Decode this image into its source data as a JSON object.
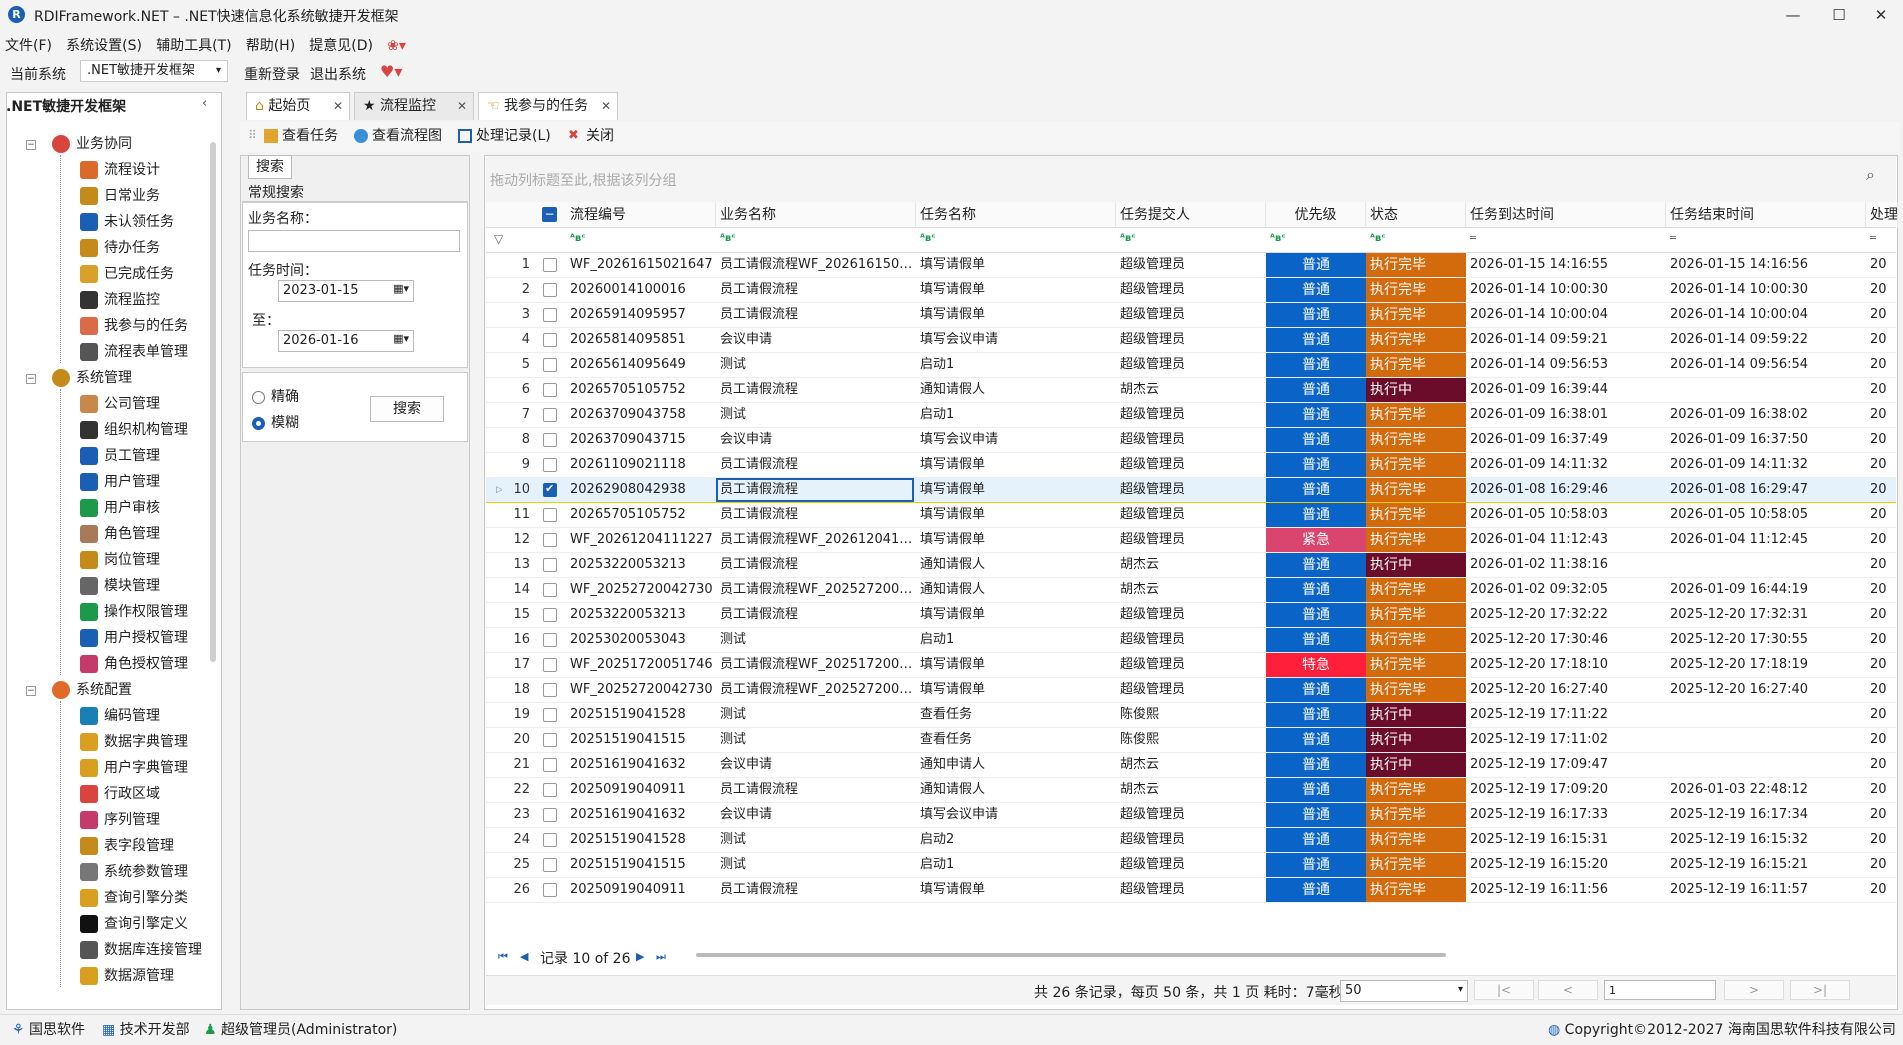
{
  "window": {
    "title": "RDIFramework.NET – .NET快速信息化系统敏捷开发框架",
    "logo": "R",
    "min": "—",
    "max": "☐",
    "close": "✕"
  },
  "menu": [
    "文件(F)",
    "系统设置(S)",
    "辅助工具(T)",
    "帮助(H)",
    "提意见(D)"
  ],
  "sysbar": {
    "label": "当前系统",
    "selected": ".NET敏捷开发框架",
    "relogin": "重新登录",
    "exit": "退出系统"
  },
  "left_panel": {
    "header": ".NET敏捷开发框架",
    "groups": [
      {
        "label": "业务协同",
        "items": [
          "流程设计",
          "日常业务",
          "未认领任务",
          "待办任务",
          "已完成任务",
          "流程监控",
          "我参与的任务",
          "流程表单管理"
        ]
      },
      {
        "label": "系统管理",
        "items": [
          "公司管理",
          "组织机构管理",
          "员工管理",
          "用户管理",
          "用户审核",
          "角色管理",
          "岗位管理",
          "模块管理",
          "操作权限管理",
          "用户授权管理",
          "角色授权管理"
        ]
      },
      {
        "label": "系统配置",
        "items": [
          "编码管理",
          "数据字典管理",
          "用户字典管理",
          "行政区域",
          "序列管理",
          "表字段管理",
          "系统参数管理",
          "查询引擎分类",
          "查询引擎定义",
          "数据库连接管理",
          "数据源管理"
        ]
      }
    ]
  },
  "tabs": [
    "起始页",
    "流程监控",
    "我参与的任务"
  ],
  "toolbar": [
    "查看任务",
    "查看流程图",
    "处理记录(L)",
    "关闭"
  ],
  "search": {
    "tab": "搜索",
    "section": "常规搜索",
    "biz_label": "业务名称：",
    "biz_value": "",
    "time_label": "任务时间：",
    "from": "2023-01-15",
    "to_label": "至：",
    "to": "2026-01-16",
    "exact": "精确",
    "fuzzy": "模糊",
    "button": "搜索"
  },
  "grid": {
    "group_hint": "拖动列标题至此,根据该列分组",
    "columns": [
      "流程编号",
      "业务名称",
      "任务名称",
      "任务提交人",
      "优先级",
      "状态",
      "任务到达时间",
      "任务结束时间",
      "处理"
    ],
    "rows": [
      {
        "n": "1",
        "id": "WF_20261615021647",
        "biz": "员工请假流程WF_202616150…",
        "task": "填写请假单",
        "user": "超级管理员",
        "pri": "普通",
        "st": "执行完毕",
        "arr": "2026-01-15 14:16:55",
        "end": "2026-01-15 14:16:56"
      },
      {
        "n": "2",
        "id": "20260014100016",
        "biz": "员工请假流程",
        "task": "填写请假单",
        "user": "超级管理员",
        "pri": "普通",
        "st": "执行完毕",
        "arr": "2026-01-14 10:00:30",
        "end": "2026-01-14 10:00:30"
      },
      {
        "n": "3",
        "id": "20265914095957",
        "biz": "员工请假流程",
        "task": "填写请假单",
        "user": "超级管理员",
        "pri": "普通",
        "st": "执行完毕",
        "arr": "2026-01-14 10:00:04",
        "end": "2026-01-14 10:00:04"
      },
      {
        "n": "4",
        "id": "20265814095851",
        "biz": "会议申请",
        "task": "填写会议申请",
        "user": "超级管理员",
        "pri": "普通",
        "st": "执行完毕",
        "arr": "2026-01-14 09:59:21",
        "end": "2026-01-14 09:59:22"
      },
      {
        "n": "5",
        "id": "20265614095649",
        "biz": "测试",
        "task": "启动1",
        "user": "超级管理员",
        "pri": "普通",
        "st": "执行完毕",
        "arr": "2026-01-14 09:56:53",
        "end": "2026-01-14 09:56:54"
      },
      {
        "n": "6",
        "id": "20265705105752",
        "biz": "员工请假流程",
        "task": "通知请假人",
        "user": "胡杰云",
        "pri": "普通",
        "st": "执行中",
        "arr": "2026-01-09 16:39:44",
        "end": ""
      },
      {
        "n": "7",
        "id": "20263709043758",
        "biz": "测试",
        "task": "启动1",
        "user": "超级管理员",
        "pri": "普通",
        "st": "执行完毕",
        "arr": "2026-01-09 16:38:01",
        "end": "2026-01-09 16:38:02"
      },
      {
        "n": "8",
        "id": "20263709043715",
        "biz": "会议申请",
        "task": "填写会议申请",
        "user": "超级管理员",
        "pri": "普通",
        "st": "执行完毕",
        "arr": "2026-01-09 16:37:49",
        "end": "2026-01-09 16:37:50"
      },
      {
        "n": "9",
        "id": "20261109021118",
        "biz": "员工请假流程",
        "task": "填写请假单",
        "user": "超级管理员",
        "pri": "普通",
        "st": "执行完毕",
        "arr": "2026-01-09 14:11:32",
        "end": "2026-01-09 14:11:32"
      },
      {
        "n": "10",
        "id": "20262908042938",
        "biz": "员工请假流程",
        "task": "填写请假单",
        "user": "超级管理员",
        "pri": "普通",
        "st": "执行完毕",
        "arr": "2026-01-08 16:29:46",
        "end": "2026-01-08 16:29:47"
      },
      {
        "n": "11",
        "id": "20265705105752",
        "biz": "员工请假流程",
        "task": "填写请假单",
        "user": "超级管理员",
        "pri": "普通",
        "st": "执行完毕",
        "arr": "2026-01-05 10:58:03",
        "end": "2026-01-05 10:58:05"
      },
      {
        "n": "12",
        "id": "WF_20261204111227",
        "biz": "员工请假流程WF_202612041…",
        "task": "填写请假单",
        "user": "超级管理员",
        "pri": "紧急",
        "st": "执行完毕",
        "arr": "2026-01-04 11:12:43",
        "end": "2026-01-04 11:12:45"
      },
      {
        "n": "13",
        "id": "20253220053213",
        "biz": "员工请假流程",
        "task": "通知请假人",
        "user": "胡杰云",
        "pri": "普通",
        "st": "执行中",
        "arr": "2026-01-02 11:38:16",
        "end": ""
      },
      {
        "n": "14",
        "id": "WF_20252720042730",
        "biz": "员工请假流程WF_202527200…",
        "task": "通知请假人",
        "user": "胡杰云",
        "pri": "普通",
        "st": "执行完毕",
        "arr": "2026-01-02 09:32:05",
        "end": "2026-01-09 16:44:19"
      },
      {
        "n": "15",
        "id": "20253220053213",
        "biz": "员工请假流程",
        "task": "填写请假单",
        "user": "超级管理员",
        "pri": "普通",
        "st": "执行完毕",
        "arr": "2025-12-20 17:32:22",
        "end": "2025-12-20 17:32:31"
      },
      {
        "n": "16",
        "id": "20253020053043",
        "biz": "测试",
        "task": "启动1",
        "user": "超级管理员",
        "pri": "普通",
        "st": "执行完毕",
        "arr": "2025-12-20 17:30:46",
        "end": "2025-12-20 17:30:55"
      },
      {
        "n": "17",
        "id": "WF_20251720051746",
        "biz": "员工请假流程WF_202517200…",
        "task": "填写请假单",
        "user": "超级管理员",
        "pri": "特急",
        "st": "执行完毕",
        "arr": "2025-12-20 17:18:10",
        "end": "2025-12-20 17:18:19"
      },
      {
        "n": "18",
        "id": "WF_20252720042730",
        "biz": "员工请假流程WF_202527200…",
        "task": "填写请假单",
        "user": "超级管理员",
        "pri": "普通",
        "st": "执行完毕",
        "arr": "2025-12-20 16:27:40",
        "end": "2025-12-20 16:27:40"
      },
      {
        "n": "19",
        "id": "20251519041528",
        "biz": "测试",
        "task": "查看任务",
        "user": "陈俊熙",
        "pri": "普通",
        "st": "执行中",
        "arr": "2025-12-19 17:11:22",
        "end": ""
      },
      {
        "n": "20",
        "id": "20251519041515",
        "biz": "测试",
        "task": "查看任务",
        "user": "陈俊熙",
        "pri": "普通",
        "st": "执行中",
        "arr": "2025-12-19 17:11:02",
        "end": ""
      },
      {
        "n": "21",
        "id": "20251619041632",
        "biz": "会议申请",
        "task": "通知申请人",
        "user": "胡杰云",
        "pri": "普通",
        "st": "执行中",
        "arr": "2025-12-19 17:09:47",
        "end": ""
      },
      {
        "n": "22",
        "id": "20250919040911",
        "biz": "员工请假流程",
        "task": "通知请假人",
        "user": "胡杰云",
        "pri": "普通",
        "st": "执行完毕",
        "arr": "2025-12-19 17:09:20",
        "end": "2026-01-03 22:48:12"
      },
      {
        "n": "23",
        "id": "20251619041632",
        "biz": "会议申请",
        "task": "填写会议申请",
        "user": "超级管理员",
        "pri": "普通",
        "st": "执行完毕",
        "arr": "2025-12-19 16:17:33",
        "end": "2025-12-19 16:17:34"
      },
      {
        "n": "24",
        "id": "20251519041528",
        "biz": "测试",
        "task": "启动2",
        "user": "超级管理员",
        "pri": "普通",
        "st": "执行完毕",
        "arr": "2025-12-19 16:15:31",
        "end": "2025-12-19 16:15:32"
      },
      {
        "n": "25",
        "id": "20251519041515",
        "biz": "测试",
        "task": "启动1",
        "user": "超级管理员",
        "pri": "普通",
        "st": "执行完毕",
        "arr": "2025-12-19 16:15:20",
        "end": "2025-12-19 16:15:21"
      },
      {
        "n": "26",
        "id": "20250919040911",
        "biz": "员工请假流程",
        "task": "填写请假单",
        "user": "超级管理员",
        "pri": "普通",
        "st": "执行完毕",
        "arr": "2025-12-19 16:11:56",
        "end": "2025-12-19 16:11:57"
      }
    ],
    "extra_col_text": "20",
    "selected_row": "10",
    "record_text": "记录 10 of 26"
  },
  "pager": {
    "summary": "共 26 条记录，每页 50 条，共 1 页 耗时：7毫秒",
    "page_size": "50",
    "page": "1",
    "first": "|<",
    "prev": "<",
    "next": ">",
    "last": ">|"
  },
  "status": {
    "company": "国思软件",
    "dept": "技术开发部",
    "user": "超级管理员(Administrator)",
    "copyright": "Copyright©2012-2027 海南国思软件科技有限公司"
  },
  "colors": {
    "pri_normal": "#0a64c8",
    "pri_urgent": "#d9456e",
    "pri_critical": "#ff1f3a",
    "st_done": "#d36a0c",
    "st_running": "#6b0d2a",
    "selected_bg": "#e5f1fb"
  }
}
